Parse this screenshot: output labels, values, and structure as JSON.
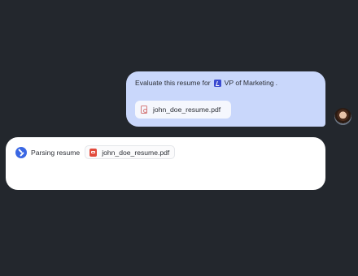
{
  "conversation": {
    "user_message": {
      "text_before": "Evaluate this resume for",
      "company_icon": "company-logo-icon",
      "text_role": "VP of Marketing",
      "text_after": ".",
      "attachment": {
        "file_name": "john_doe_resume.pdf",
        "icon": "pdf-file-icon"
      }
    },
    "agent_message": {
      "agent_icon": "agent-logo-icon",
      "status": "Parsing resume",
      "attachment": {
        "file_name": "john_doe_resume.pdf",
        "icon": "pdf-file-icon"
      }
    }
  },
  "colors": {
    "background": "#23272d",
    "user_bubble": "#c9d7fb",
    "agent_bubble": "#ffffff",
    "agent_logo": "#3a67e3",
    "pdf_icon": "#e24a3b"
  }
}
